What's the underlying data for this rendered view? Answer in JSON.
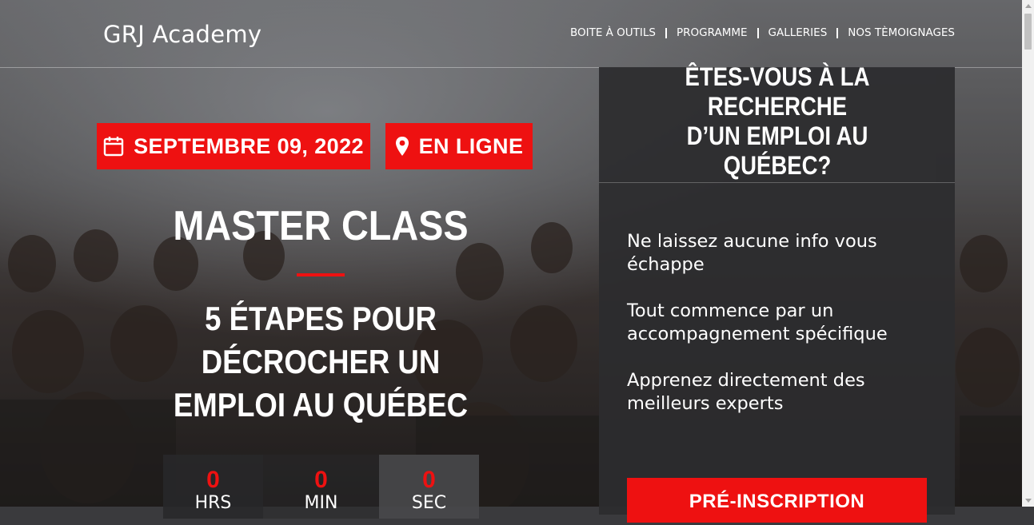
{
  "brand": {
    "logo": "GRJ Academy"
  },
  "nav": {
    "items": [
      "BOITE À OUTILS",
      "PROGRAMME",
      "GALLERIES",
      "NOS TÈMOIGNAGES"
    ]
  },
  "event": {
    "date": "SEPTEMBRE 09, 2022",
    "date_icon": "calendar-icon",
    "location": "EN LIGNE",
    "location_icon": "map-pin-icon"
  },
  "hero": {
    "title": "MASTER CLASS",
    "subtitle_line1": "5 ÉTAPES POUR DÉCROCHER UN",
    "subtitle_line2": "EMPLOI AU QUÉBEC"
  },
  "countdown": [
    {
      "value": "0",
      "label": "HRS"
    },
    {
      "value": "0",
      "label": "MIN"
    },
    {
      "value": "0",
      "label": "SEC"
    }
  ],
  "panel": {
    "title_line1": "ÊTES-VOUS À LA RECHERCHE",
    "title_line2": "D’UN EMPLOI AU QUÉBEC?",
    "benefits": [
      "Ne laissez aucune info vous échappe",
      "Tout commence par un accompagnement spécifique",
      "Apprenez directement des meilleurs experts"
    ],
    "cta": "PRÉ-INSCRIPTION"
  },
  "colors": {
    "accent": "#ee1111",
    "panel": "#2c2c2e",
    "text": "#ffffff"
  }
}
